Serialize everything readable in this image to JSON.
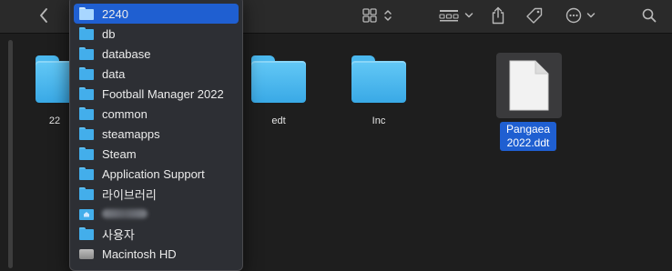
{
  "colors": {
    "accent": "#1f5fd1",
    "folder": "#4bb8ee",
    "window_bg": "#1e1e1e",
    "menu_bg": "#2d2f34"
  },
  "toolbar": {
    "back_icon": "chevron-left-icon",
    "view_icon": "grid-view-icon",
    "group_icon": "group-by-icon",
    "share_icon": "share-icon",
    "tag_icon": "tag-icon",
    "more_icon": "ellipsis-circle-icon",
    "search_icon": "search-icon"
  },
  "files": [
    {
      "label": "22",
      "kind": "folder"
    },
    {
      "label": "edt",
      "kind": "folder"
    },
    {
      "label": "Inc",
      "kind": "folder"
    },
    {
      "label": "Pangaea 2022.ddt",
      "label_line1": "Pangaea",
      "label_line2": "2022.ddt",
      "kind": "document",
      "selected": true
    }
  ],
  "path_menu": {
    "items": [
      {
        "label": "2240",
        "icon": "folder-icon",
        "selected": true
      },
      {
        "label": "db",
        "icon": "folder-icon"
      },
      {
        "label": "database",
        "icon": "folder-icon"
      },
      {
        "label": "data",
        "icon": "folder-icon"
      },
      {
        "label": "Football Manager 2022",
        "icon": "folder-icon"
      },
      {
        "label": "common",
        "icon": "folder-icon"
      },
      {
        "label": "steamapps",
        "icon": "folder-icon"
      },
      {
        "label": "Steam",
        "icon": "folder-icon"
      },
      {
        "label": "Application Support",
        "icon": "folder-icon"
      },
      {
        "label": "라이브러리",
        "icon": "folder-icon"
      },
      {
        "label": "",
        "icon": "home-folder-icon",
        "redacted": true
      },
      {
        "label": "사용자",
        "icon": "folder-icon"
      },
      {
        "label": "Macintosh HD",
        "icon": "disk-icon"
      }
    ]
  }
}
